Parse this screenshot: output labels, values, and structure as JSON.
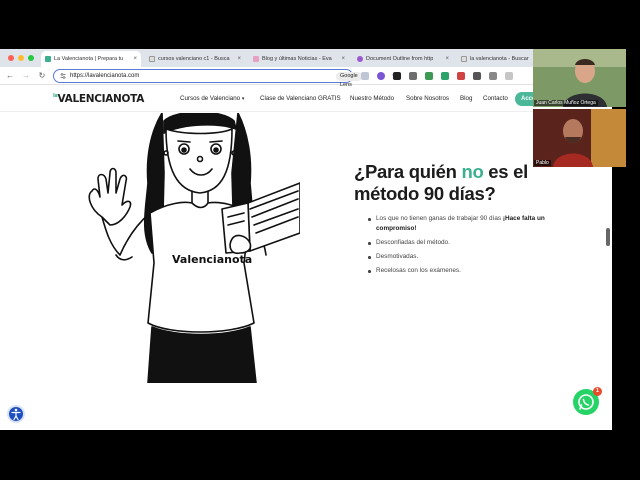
{
  "browser": {
    "tabs": [
      {
        "label": "La Valencianota | Prepara tu",
        "active": true
      },
      {
        "label": "cursos valenciano c1 - Busca"
      },
      {
        "label": "Blog y últimas Noticias - Eva"
      },
      {
        "label": "Document Outline from http"
      },
      {
        "label": "la valencianota - Buscar"
      }
    ],
    "url": "https://lavalencianota.com",
    "lens_label": "Google Lens"
  },
  "site": {
    "logo_prefix": "la",
    "logo": "VALENCIANOTA",
    "nav": [
      "Cursos de Valenciano",
      "Clase de Valenciano GRATIS",
      "Nuestro Método",
      "Sobre Nosotros",
      "Blog",
      "Contacto"
    ],
    "cta": "Acce"
  },
  "main": {
    "heading_pre": "¿Para quién ",
    "heading_highlight": "no",
    "heading_post": " es el método 90 días?",
    "shirt_text": "Valencianota",
    "items": [
      {
        "text": "Los que no tienen ganas de trabajar 90 días ",
        "bold": "¡Hace falta un compromiso!"
      },
      {
        "text": "Desconfiadas del método.",
        "bold": ""
      },
      {
        "text": "Desmotivadas.",
        "bold": ""
      },
      {
        "text": "Recelosas con los exámenes.",
        "bold": ""
      }
    ],
    "whatsapp_badge": "1"
  },
  "video": {
    "participant1": "Juan Carlos Muñoz Ortega",
    "participant2": "Pablo"
  },
  "colors": {
    "accent": "#3bb08f",
    "cta": "#4bb899",
    "whatsapp": "#25d366"
  }
}
